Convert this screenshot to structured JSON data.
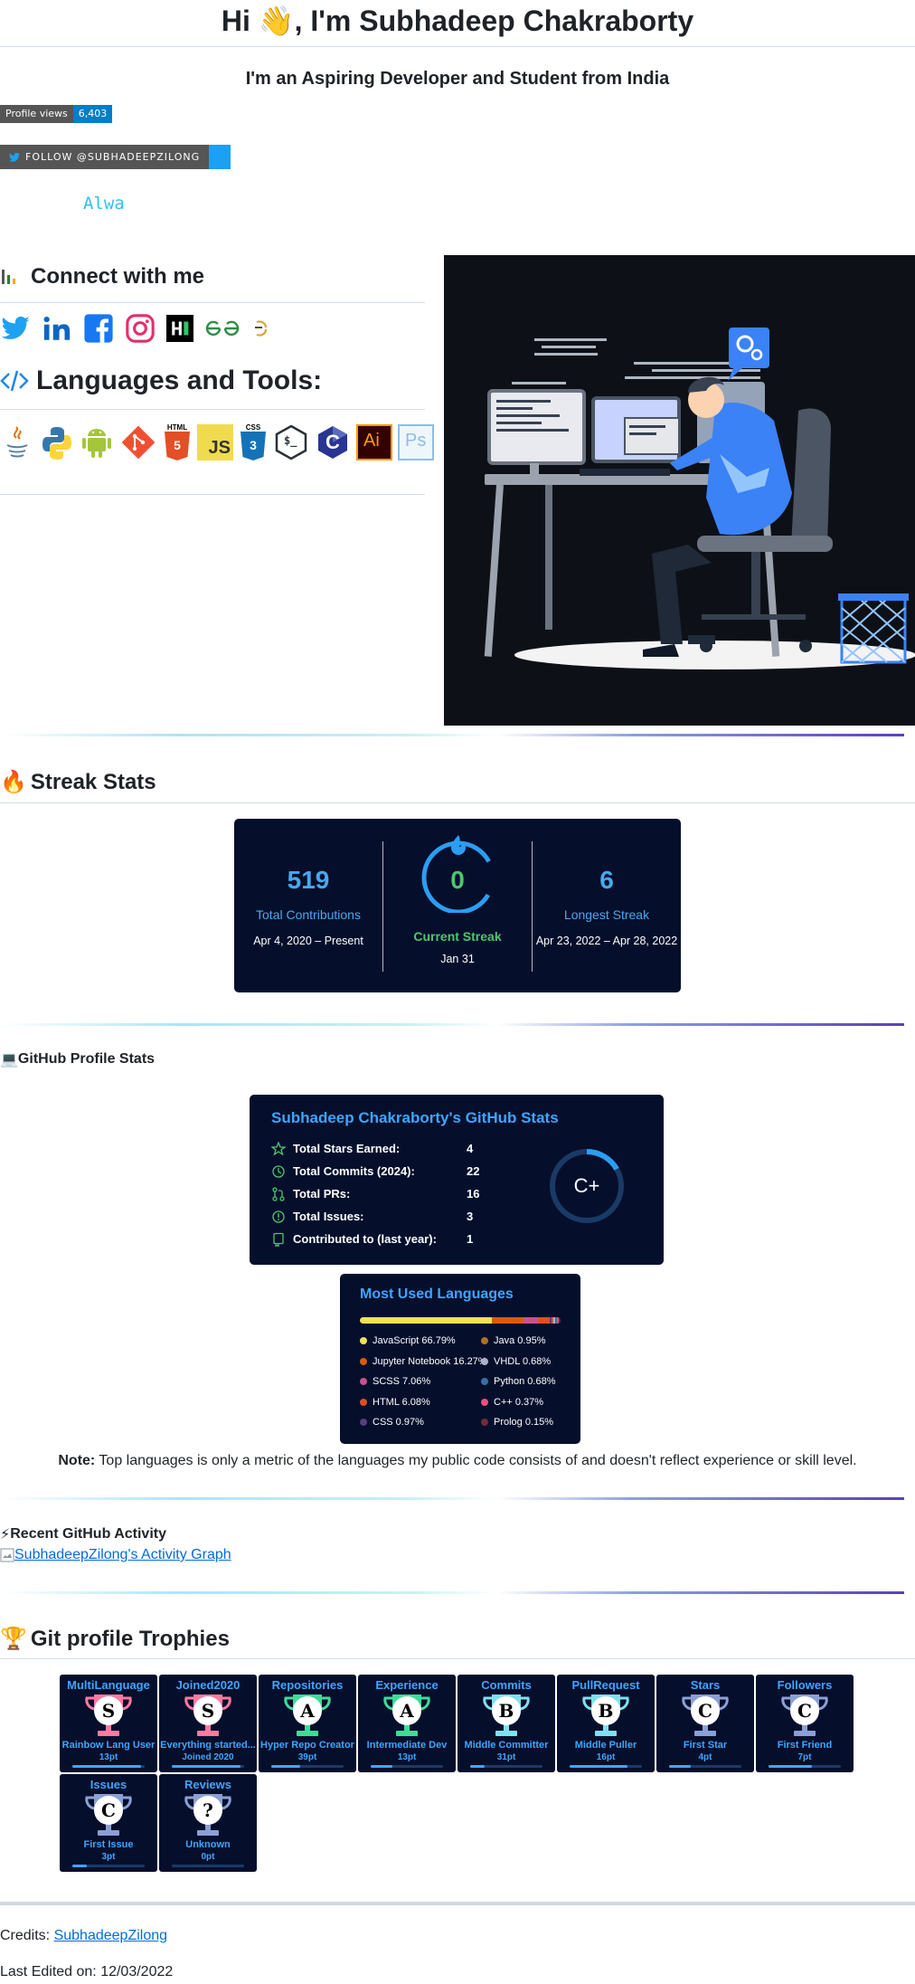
{
  "header": {
    "title_pre": "Hi",
    "title_post": ", I'm Subhadeep Chakraborty",
    "wave_emoji": "👋",
    "subtitle": "I'm an Aspiring Developer and Student from India"
  },
  "badges": {
    "views_label": "Profile views",
    "views_count": "6,403",
    "twitter_label": "FOLLOW @SUBHADEEPZILONG"
  },
  "typing_text": "Alwa",
  "connect": {
    "heading": "Connect with me",
    "socials": [
      {
        "name": "twitter-icon",
        "color": "#1da1f2"
      },
      {
        "name": "linkedin-icon",
        "color": "#0a66c2"
      },
      {
        "name": "facebook-icon",
        "color": "#1877f2"
      },
      {
        "name": "instagram-icon",
        "color": "#e1306c"
      },
      {
        "name": "hackerrank-icon",
        "color": "#000000"
      },
      {
        "name": "geeksforgeeks-icon",
        "color": "#2f8d46"
      },
      {
        "name": "codechef-icon",
        "color": "#e09f3e"
      }
    ]
  },
  "languages": {
    "heading": "Languages and Tools:",
    "tools": [
      {
        "name": "java-icon"
      },
      {
        "name": "python-icon"
      },
      {
        "name": "android-icon"
      },
      {
        "name": "git-icon"
      },
      {
        "name": "html5-icon",
        "label": "HTML"
      },
      {
        "name": "javascript-icon",
        "label": "JS"
      },
      {
        "name": "css3-icon",
        "label": "CSS"
      },
      {
        "name": "bash-icon",
        "label": "$_"
      },
      {
        "name": "c-icon",
        "label": "C"
      },
      {
        "name": "illustrator-icon",
        "label": "Ai"
      },
      {
        "name": "photoshop-icon",
        "label": "Ps"
      }
    ]
  },
  "streak": {
    "heading": "Streak Stats",
    "fire_emoji": "🔥",
    "total_value": "519",
    "total_label": "Total Contributions",
    "total_range": "Apr 4, 2020 – Present",
    "current_value": "0",
    "current_label": "Current Streak",
    "current_date": "Jan 31",
    "longest_value": "6",
    "longest_label": "Longest Streak",
    "longest_range": "Apr 23, 2022 – Apr 28, 2022"
  },
  "github_stats": {
    "heading": "GitHub Profile Stats",
    "laptop_emoji": "💻",
    "card_title": "Subhadeep Chakraborty's GitHub Stats",
    "rows": [
      {
        "label": "Total Stars Earned:",
        "value": "4"
      },
      {
        "label": "Total Commits (2024):",
        "value": "22"
      },
      {
        "label": "Total PRs:",
        "value": "16"
      },
      {
        "label": "Total Issues:",
        "value": "3"
      },
      {
        "label": "Contributed to (last year):",
        "value": "1"
      }
    ],
    "grade": "C+"
  },
  "top_langs": {
    "title": "Most Used Languages",
    "items": [
      {
        "label": "JavaScript 66.79%",
        "color": "#f1e05a",
        "pct": 66.79
      },
      {
        "label": "Java 0.95%",
        "color": "#b07219",
        "pct": 0.95
      },
      {
        "label": "Jupyter Notebook 16.27%",
        "color": "#da5b0b",
        "pct": 16.27
      },
      {
        "label": "VHDL 0.68%",
        "color": "#adb2cb",
        "pct": 0.68
      },
      {
        "label": "SCSS 7.06%",
        "color": "#c6538c",
        "pct": 7.06
      },
      {
        "label": "Python 0.68%",
        "color": "#3572a5",
        "pct": 0.68
      },
      {
        "label": "HTML 6.08%",
        "color": "#e34c26",
        "pct": 6.08
      },
      {
        "label": "C++ 0.37%",
        "color": "#f34b7d",
        "pct": 0.37
      },
      {
        "label": "CSS 0.97%",
        "color": "#563d7c",
        "pct": 0.97
      },
      {
        "label": "Prolog 0.15%",
        "color": "#74283c",
        "pct": 0.15
      }
    ]
  },
  "note": {
    "bold": "Note:",
    "text": " Top languages is only a metric of the languages my public code consists of and doesn't reflect experience or skill level."
  },
  "activity": {
    "heading": "Recent GitHub Activity",
    "bolt_emoji": "⚡",
    "graph_alt": "SubhadeepZilong's Activity Graph"
  },
  "trophies": {
    "heading": "Git profile Trophies",
    "trophy_emoji": "🏆",
    "items": [
      {
        "title": "MultiLanguage",
        "rank": "S",
        "subtitle": "Rainbow Lang User",
        "points": "13pt",
        "progress": 0.95,
        "color": "#ff7aa0"
      },
      {
        "title": "Joined2020",
        "rank": "S",
        "subtitle": "Everything started...",
        "points": "Joined 2020",
        "progress": 0.95,
        "color": "#ff7aa0"
      },
      {
        "title": "Repositories",
        "rank": "A",
        "subtitle": "Hyper Repo Creator",
        "points": "39pt",
        "progress": 0.4,
        "color": "#3ddc97"
      },
      {
        "title": "Experience",
        "rank": "A",
        "subtitle": "Intermediate Dev",
        "points": "13pt",
        "progress": 0.3,
        "color": "#3ddc97"
      },
      {
        "title": "Commits",
        "rank": "B",
        "subtitle": "Middle Committer",
        "points": "31pt",
        "progress": 0.2,
        "color": "#7fe0f0"
      },
      {
        "title": "PullRequest",
        "rank": "B",
        "subtitle": "Middle Puller",
        "points": "16pt",
        "progress": 0.8,
        "color": "#7fe0f0"
      },
      {
        "title": "Stars",
        "rank": "C",
        "subtitle": "First Star",
        "points": "4pt",
        "progress": 0.3,
        "color": "#8aa0d6"
      },
      {
        "title": "Followers",
        "rank": "C",
        "subtitle": "First Friend",
        "points": "7pt",
        "progress": 0.6,
        "color": "#8aa0d6"
      },
      {
        "title": "Issues",
        "rank": "C",
        "subtitle": "First Issue",
        "points": "3pt",
        "progress": 0.2,
        "color": "#8aa0d6"
      },
      {
        "title": "Reviews",
        "rank": "?",
        "subtitle": "Unknown",
        "points": "0pt",
        "progress": 0.0,
        "color": "#8aa0d6"
      }
    ]
  },
  "footer": {
    "credits_label": "Credits: ",
    "credits_link": "SubhadeepZilong",
    "last_edited": "Last Edited on: 12/03/2022"
  }
}
